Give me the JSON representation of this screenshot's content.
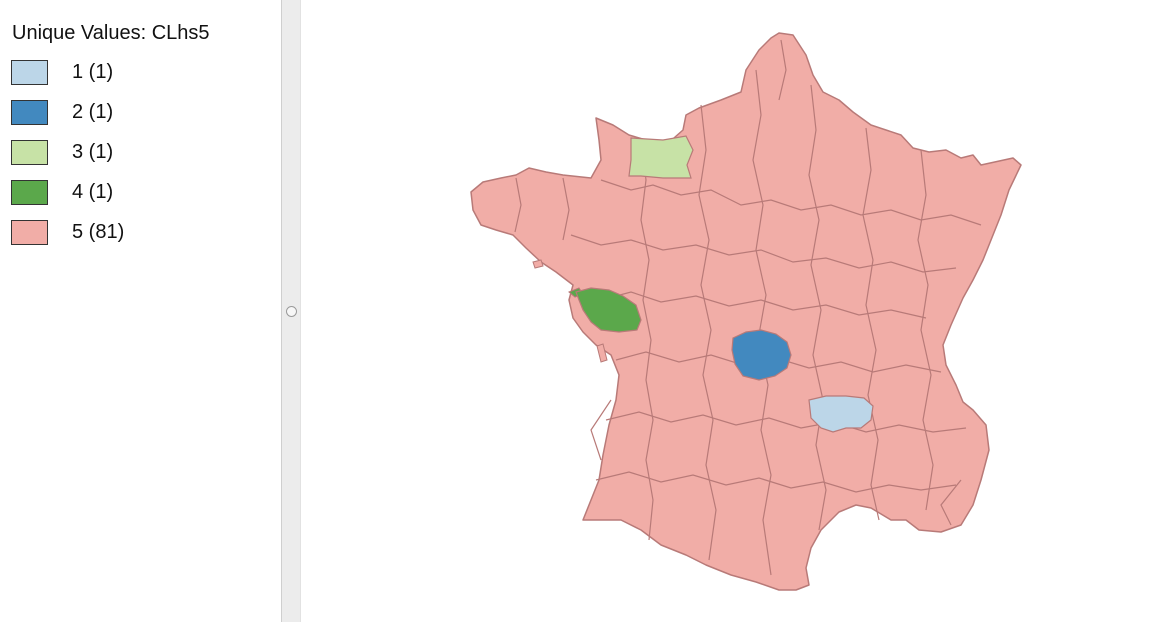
{
  "legend": {
    "title": "Unique Values: CLhs5",
    "items": [
      {
        "label": "1 (1)",
        "color": "#bcd6e8"
      },
      {
        "label": "2 (1)",
        "color": "#4289bf"
      },
      {
        "label": "3 (1)",
        "color": "#c7e2a6"
      },
      {
        "label": "4 (1)",
        "color": "#5ba84b"
      },
      {
        "label": "5 (81)",
        "color": "#f1ada7"
      }
    ]
  },
  "map": {
    "base_category_color": "#f1ada7",
    "border_color": "#b87a78",
    "highlighted_regions": [
      {
        "category": "1",
        "color": "#bcd6e8"
      },
      {
        "category": "2",
        "color": "#4289bf"
      },
      {
        "category": "3",
        "color": "#c7e2a6"
      },
      {
        "category": "4",
        "color": "#5ba84b"
      }
    ]
  }
}
